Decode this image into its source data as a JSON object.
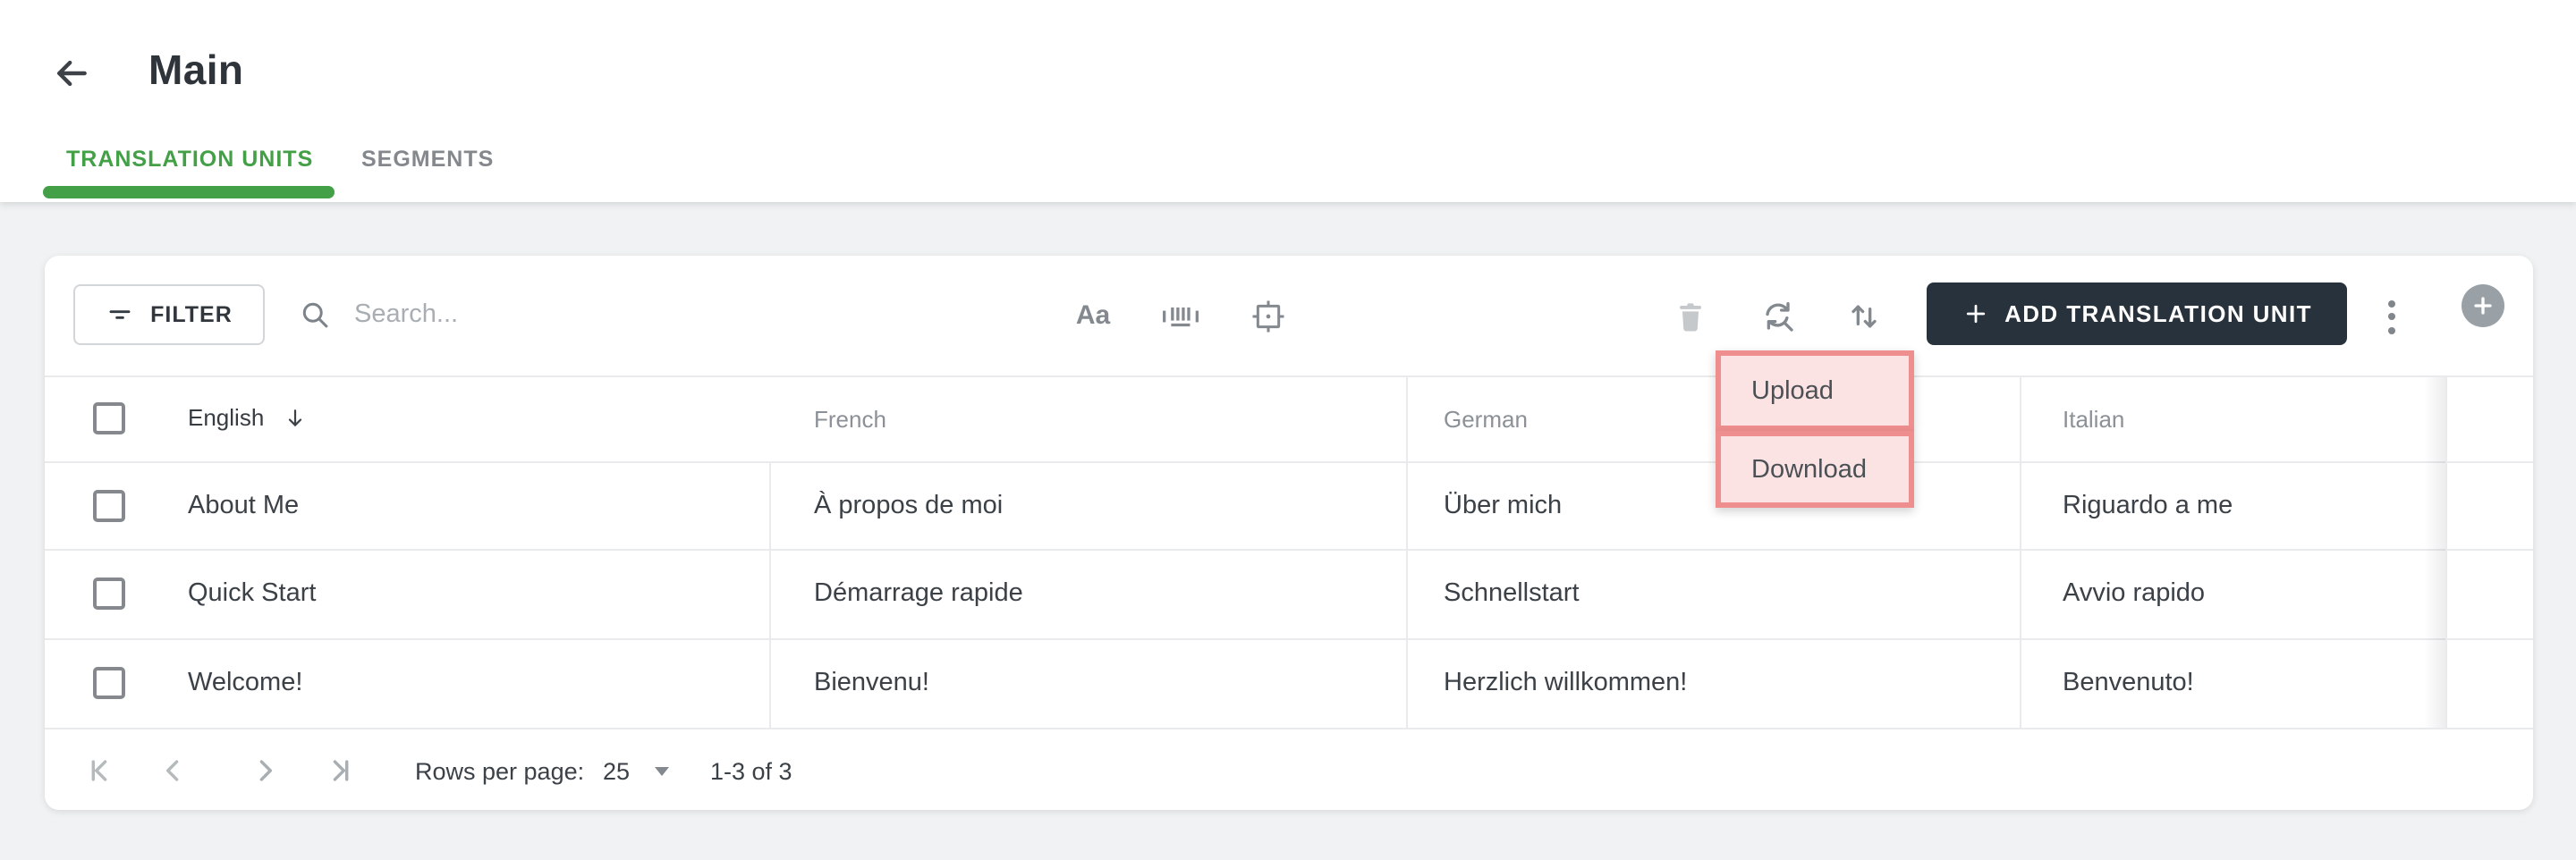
{
  "header": {
    "title": "Main"
  },
  "tabs": [
    {
      "label": "TRANSLATION UNITS",
      "active": true
    },
    {
      "label": "SEGMENTS",
      "active": false
    }
  ],
  "toolbar": {
    "filter_label": "FILTER",
    "search_placeholder": "Search...",
    "match_case_glyph": "Aa",
    "add_button_label": "ADD TRANSLATION UNIT",
    "icon_names": [
      "filter-icon",
      "search-icon",
      "match-case-icon",
      "barcode-icon",
      "focus-frame-icon",
      "trash-icon",
      "find-replace-icon",
      "import-export-icon",
      "kebab-menu-icon",
      "add-circle-icon"
    ]
  },
  "menu": {
    "items": [
      {
        "label": "Upload"
      },
      {
        "label": "Download"
      }
    ],
    "highlight_fill": "#fce3e3",
    "highlight_border": "#ee8e8e"
  },
  "table": {
    "columns": [
      {
        "label": "English",
        "sorted": "desc"
      },
      {
        "label": "French"
      },
      {
        "label": "German"
      },
      {
        "label": "Italian"
      }
    ],
    "rows": [
      {
        "english": "About Me",
        "french": "À propos de moi",
        "german": "Über mich",
        "italian": "Riguardo a me"
      },
      {
        "english": "Quick Start",
        "french": "Démarrage rapide",
        "german": "Schnellstart",
        "italian": "Avvio rapido"
      },
      {
        "english": "Welcome!",
        "french": "Bienvenu!",
        "german": "Herzlich willkommen!",
        "italian": "Benvenuto!"
      }
    ]
  },
  "pagination": {
    "rows_per_page_label": "Rows per page:",
    "rows_per_page_value": "25",
    "range_label": "1-3 of 3"
  },
  "colors": {
    "accent_green": "#43a047",
    "primary_button_bg": "#28323c",
    "annotation_fill": "#fce3e3",
    "annotation_border": "#ee8e8e",
    "page_background": "#f0f2f3"
  }
}
